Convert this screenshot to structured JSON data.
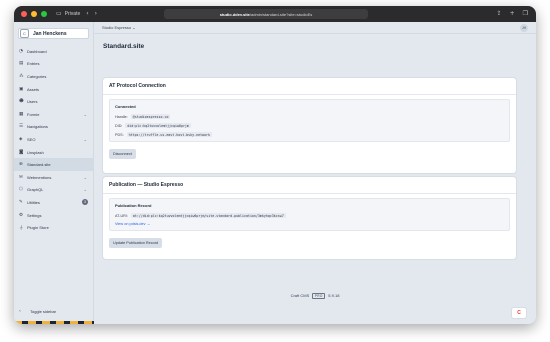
{
  "browser": {
    "private_label": "Private",
    "url_host": "studio.ddev.site",
    "url_path": "/admin/standard-site?site=studioEs"
  },
  "sidebar": {
    "site_initial": "C",
    "site_name": "Jan Henckens",
    "items": [
      {
        "label": "Dashboard",
        "icon": "gauge-icon",
        "glyph": "◔"
      },
      {
        "label": "Entries",
        "icon": "newspaper-icon",
        "glyph": "▤"
      },
      {
        "label": "Categories",
        "icon": "sitemap-icon",
        "glyph": "⁂"
      },
      {
        "label": "Assets",
        "icon": "image-icon",
        "glyph": "▣"
      },
      {
        "label": "Users",
        "icon": "users-icon",
        "glyph": "☻"
      },
      {
        "label": "Formie",
        "icon": "form-icon",
        "glyph": "▦",
        "chevron": true
      },
      {
        "label": "Navigations",
        "icon": "list-icon",
        "glyph": "☰"
      },
      {
        "label": "SEO",
        "icon": "seo-icon",
        "glyph": "◈",
        "chevron": true
      },
      {
        "label": "Unsplash",
        "icon": "camera-icon",
        "glyph": "◙"
      },
      {
        "label": "Standard.site",
        "icon": "standard-site-icon",
        "glyph": "⊛",
        "active": true
      },
      {
        "label": "Webmentions",
        "icon": "webmentions-icon",
        "glyph": "✉",
        "chevron": true
      },
      {
        "label": "GraphQL",
        "icon": "graphql-icon",
        "glyph": "⬡",
        "chevron": true
      },
      {
        "label": "Utilities",
        "icon": "wrench-icon",
        "glyph": "✎",
        "badge": "3"
      },
      {
        "label": "Settings",
        "icon": "gear-icon",
        "glyph": "⚙"
      },
      {
        "label": "Plugin Store",
        "icon": "plug-icon",
        "glyph": "⏚"
      }
    ],
    "toggle_label": "Toggle sidebar"
  },
  "topbar": {
    "site_selector": "Studio Espresso",
    "avatar_initials": "JH"
  },
  "page": {
    "title": "Standard.site"
  },
  "at_protocol": {
    "heading": "AT Protocol Connection",
    "status": "Connected",
    "handle_label": "Handle:",
    "handle_value": "@studioespresso.co",
    "did_label": "DID:",
    "did_value": "did:plc:kq2tuvvolemtjjcqiw6prjm",
    "pds_label": "PDS:",
    "pds_value": "https://truffle.us-east.host.bsky.network",
    "disconnect_label": "Disconnect"
  },
  "publication": {
    "heading": "Publication — Studio Espresso",
    "record_title": "Publication Record",
    "aturi_label": "AT-URI:",
    "aturi_value": "at://did:plc:kq2tuvvolemtjjcqiw6prjm/site.standard.publication/3mkyhqc3kcsw7",
    "view_link": "View on pdsls.dev →",
    "update_label": "Update Publication Record"
  },
  "footer": {
    "product": "Craft CMS",
    "edition": "PRO",
    "version": "5.9.18"
  },
  "colors": {
    "accent": "#2563eb",
    "sidebar_bg": "#e3e8ee",
    "craft_red": "#e53935"
  }
}
